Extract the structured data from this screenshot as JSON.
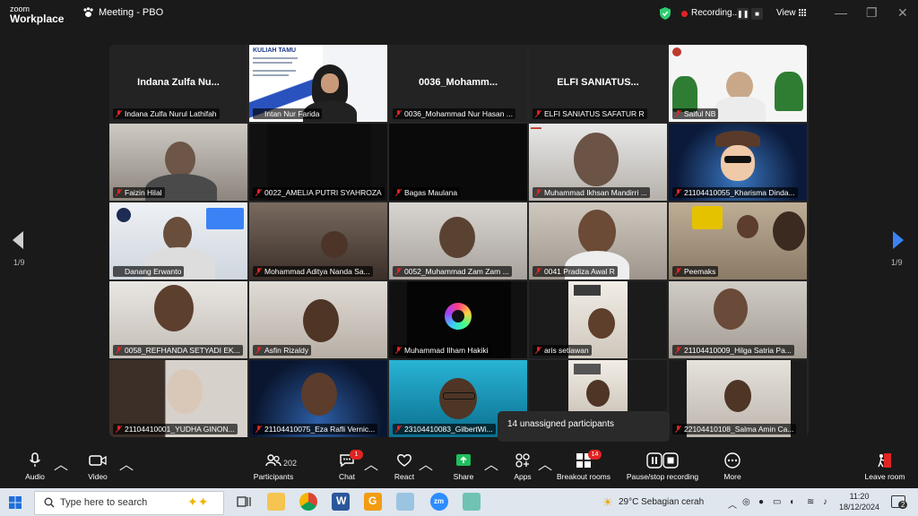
{
  "app": {
    "logo_line1": "zoom",
    "logo_line2": "Workplace",
    "meeting_title": "Meeting - PBO"
  },
  "titlebar": {
    "recording_label": "Recording...",
    "view_label": "View"
  },
  "pagination": {
    "left": "1/9",
    "right": "1/9"
  },
  "tiles": [
    {
      "name": "Indana Zulfa Nurul Lathifah",
      "big": "Indana Zulfa Nu..."
    },
    {
      "name": "Intan Nur Farida"
    },
    {
      "name": "0036_Mohammad Nur Hasan ...",
      "big": "0036_Mohamm..."
    },
    {
      "name": "ELFI SANIATUS SAFATUR R",
      "big": "ELFI SANIATUS..."
    },
    {
      "name": "Saiful NB"
    },
    {
      "name": "Faizin Hilal"
    },
    {
      "name": "0022_AMELIA PUTRI SYAHROZA"
    },
    {
      "name": "Bagas Maulana"
    },
    {
      "name": "Muhammad Ikhsan Mandirri ..."
    },
    {
      "name": "21104410055_Kharisma Dinda..."
    },
    {
      "name": "Danang Erwanto"
    },
    {
      "name": "Mohammad Aditya Nanda Sa..."
    },
    {
      "name": "0052_Muhammad Zam Zam ..."
    },
    {
      "name": "0041 Pradiza Awal R"
    },
    {
      "name": "Peemaks"
    },
    {
      "name": "0058_REFHANDA SETYADI EK..."
    },
    {
      "name": "Asfin Rizaldy"
    },
    {
      "name": "Muhammad Ilham Hakiki"
    },
    {
      "name": "aris setiawan"
    },
    {
      "name": "21104410009_Hilga Satria Pa..."
    },
    {
      "name": "21104410001_YUDHA GINON..."
    },
    {
      "name": "21104410075_Eza Rafli Vernic..."
    },
    {
      "name": "23104410083_GilbertWi..."
    },
    {
      "name": ""
    },
    {
      "name": "22104410108_Salma Amin Ca..."
    }
  ],
  "slide_text": {
    "header": "KULIAH TAMU"
  },
  "tooltip": {
    "text": "14 unassigned participants"
  },
  "toolbar": {
    "audio": "Audio",
    "video": "Video",
    "participants": "Participants",
    "participants_count": "202",
    "chat": "Chat",
    "chat_badge": "1",
    "react": "React",
    "share": "Share",
    "apps": "Apps",
    "breakout": "Breakout rooms",
    "breakout_badge": "14",
    "record": "Pause/stop recording",
    "more": "More",
    "leave": "Leave room"
  },
  "taskbar": {
    "search_placeholder": "Type here to search",
    "weather": "29°C  Sebagian cerah",
    "time": "11:20",
    "date": "18/12/2024",
    "notif_count": "2"
  },
  "colors": {
    "active_border": "#2ecc71",
    "accent": "#3b82f6",
    "badge": "#e02424",
    "muted_mic": "#e02424"
  }
}
